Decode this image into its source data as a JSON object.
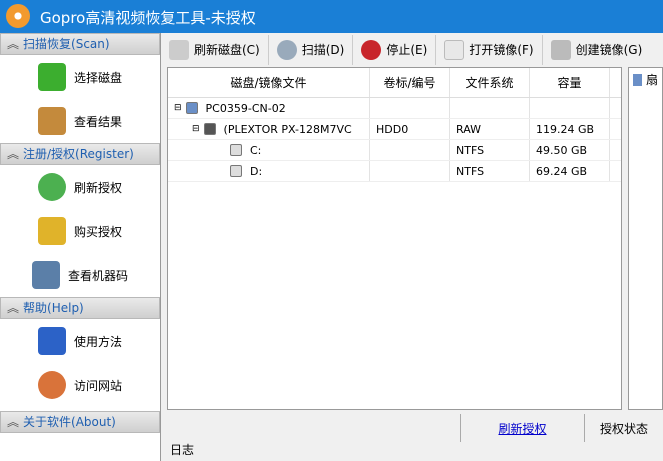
{
  "window": {
    "title": "Gopro高清视频恢复工具-未授权"
  },
  "sidebar": {
    "sections": [
      {
        "label": "扫描恢复(Scan)",
        "items": [
          {
            "label": "选择磁盘",
            "icon": "plus-icon"
          },
          {
            "label": "查看结果",
            "icon": "clipboard-icon"
          }
        ]
      },
      {
        "label": "注册/授权(Register)",
        "items": [
          {
            "label": "刷新授权",
            "icon": "refresh-icon"
          },
          {
            "label": "购买授权",
            "icon": "key-icon"
          },
          {
            "label": "查看机器码",
            "icon": "computer-search-icon"
          }
        ]
      },
      {
        "label": "帮助(Help)",
        "items": [
          {
            "label": "使用方法",
            "icon": "help-book-icon"
          },
          {
            "label": "访问网站",
            "icon": "home-globe-icon"
          }
        ]
      },
      {
        "label": "关于软件(About)",
        "items": []
      }
    ]
  },
  "toolbar": {
    "refresh": "刷新磁盘(C)",
    "scan": "扫描(D)",
    "stop": "停止(E)",
    "open_image": "打开镜像(F)",
    "create_image": "创建镜像(G)"
  },
  "table": {
    "headers": [
      "磁盘/镜像文件",
      "卷标/编号",
      "文件系统",
      "容量"
    ],
    "rows": [
      {
        "name": "PC0359-CN-02",
        "label": "",
        "fs": "",
        "size": ""
      },
      {
        "name": "(PLEXTOR PX-128M7VC",
        "label": "HDD0",
        "fs": "RAW",
        "size": "119.24 GB"
      },
      {
        "name": "C:",
        "label": "",
        "fs": "NTFS",
        "size": "49.50 GB"
      },
      {
        "name": "D:",
        "label": "",
        "fs": "NTFS",
        "size": "69.24 GB"
      }
    ]
  },
  "right_panel": {
    "label": "扇"
  },
  "status": {
    "refresh_link": "刷新授权",
    "auth_state": "授权状态"
  },
  "log": {
    "label": "日志"
  },
  "colors": {
    "title_bar": "#1a7fd6",
    "link": "#0000cc"
  }
}
